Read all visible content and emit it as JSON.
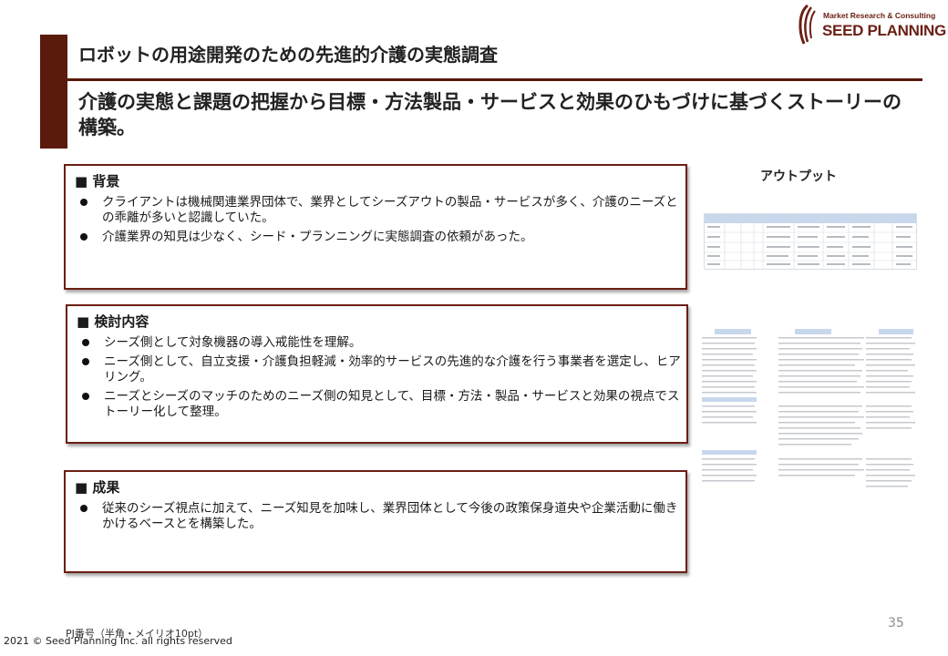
{
  "logo": {
    "tagline": "Market Research & Consulting",
    "name": "SEED PLANNING"
  },
  "title": "ロボットの用途開発のための先進的介護の実態調査",
  "subtitle": "介護の実態と課題の把握から目標・方法製品・サービスと効果のひもづけに基づくストーリーの構築。",
  "sections": {
    "background": {
      "heading": "■ 背景",
      "items": [
        "クライアントは機械関連業界団体で、業界としてシーズアウトの製品・サービスが多く、介護のニーズとの乖離が多いと認識していた。",
        "介護業界の知見は少なく、シード・プランニングに実態調査の依頼があった。"
      ]
    },
    "study": {
      "heading": "■ 検討内容",
      "items": [
        "シーズ側として対象機器の導入戒能性を理解。",
        "ニーズ側として、自立支援・介護負担軽減・効率的サービスの先進的な介護を行う事業者を選定し、ヒアリング。",
        "ニーズとシーズのマッチのためのニーズ側の知見として、目標・方法・製品・サービスと効果の視点でストーリー化して整理。"
      ]
    },
    "results": {
      "heading": "■ 成果",
      "items": [
        "従来のシーズ視点に加えて、ニーズ知見を加味し、業界団体として今後の政策保身道央や企業活動に働きかけるベースとを構築した。"
      ]
    }
  },
  "output": {
    "label": "アウトプット"
  },
  "footer": {
    "page_number": "35",
    "pj_number": "PJ番号（半角・メイリオ10pt）",
    "copyright": "2021 © Seed Planning Inc. all rights reserved"
  },
  "colors": {
    "accent": "#5a1a0c",
    "box_border": "#6b1f14",
    "thumb_header": "#c8d7ec"
  }
}
